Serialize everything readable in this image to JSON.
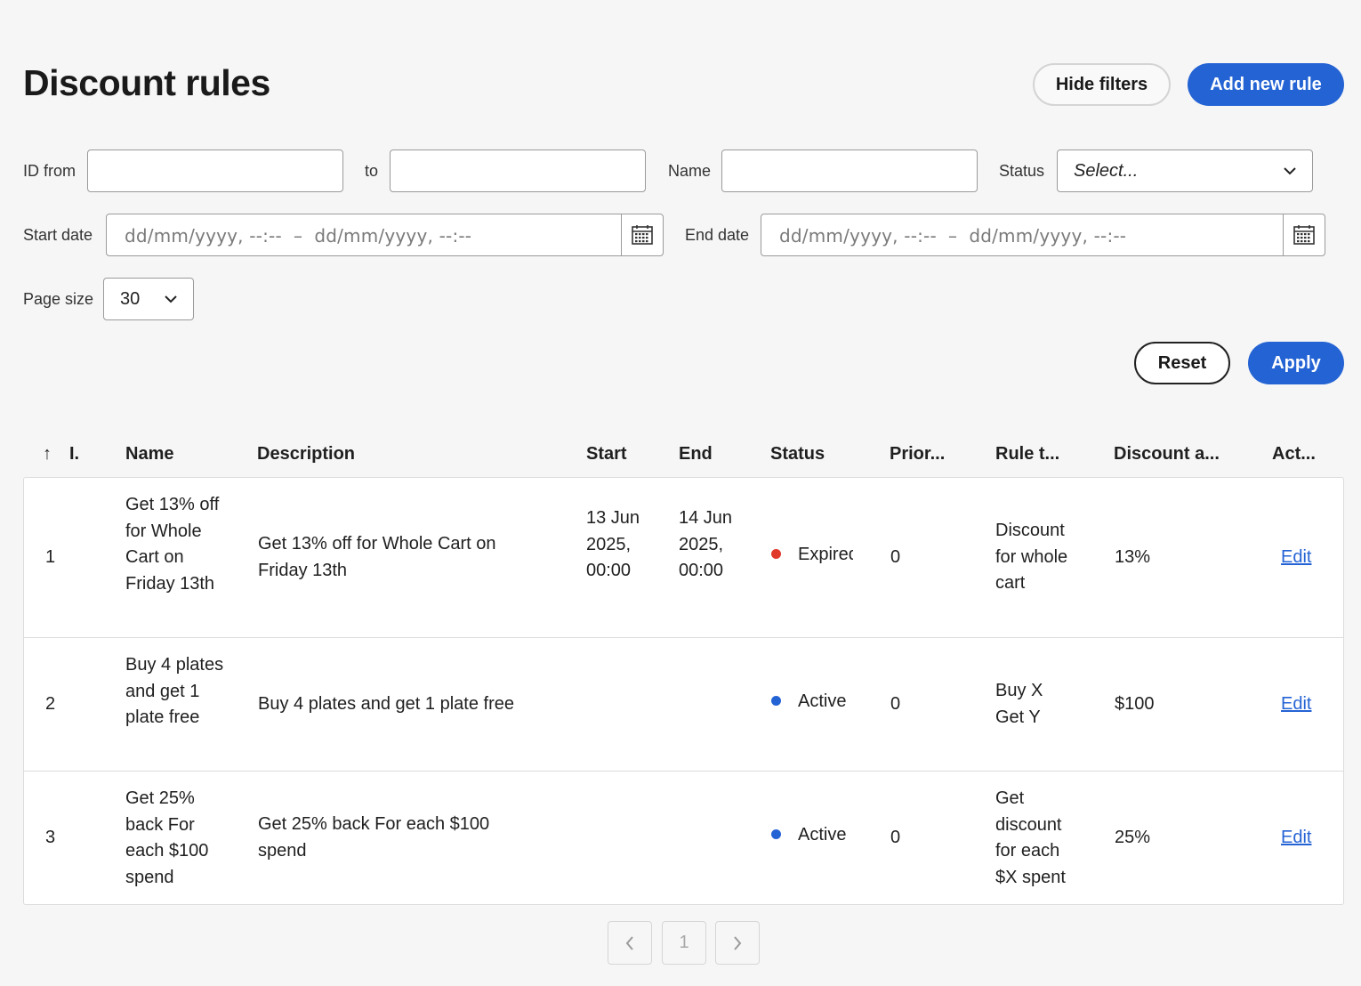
{
  "page": {
    "title": "Discount rules"
  },
  "header": {
    "hide_filters_label": "Hide filters",
    "add_rule_label": "Add new rule"
  },
  "filters": {
    "id_from_label": "ID from",
    "id_to_label": "to",
    "name_label": "Name",
    "status_label": "Status",
    "status_placeholder": "Select...",
    "start_date_label": "Start date",
    "end_date_label": "End date",
    "date_range_placeholder": "dd/mm/yyyy, --:--  –  dd/mm/yyyy, --:--",
    "page_size_label": "Page size",
    "page_size_value": "30",
    "reset_label": "Reset",
    "apply_label": "Apply"
  },
  "table": {
    "columns": [
      "I.",
      "Name",
      "Description",
      "Start",
      "End",
      "Status",
      "Prior...",
      "Rule t...",
      "Discount a...",
      "Act..."
    ],
    "sort_indicator": "↑",
    "rows": [
      {
        "id": "1",
        "name": "Get 13% off for Whole Cart on Friday 13th",
        "description": "Get 13% off for Whole Cart on Friday 13th",
        "start": "13 Jun 2025, 00:00",
        "end": "14 Jun 2025, 00:00",
        "status": "Expired",
        "status_color": "#e0382b",
        "priority": "0",
        "rule_type": "Discount for whole cart",
        "discount": "13%",
        "action": "Edit"
      },
      {
        "id": "2",
        "name": "Buy 4 plates and get 1 plate free",
        "description": "Buy 4 plates and get 1 plate free",
        "start": "",
        "end": "",
        "status": "Active",
        "status_color": "#2463d4",
        "priority": "0",
        "rule_type": "Buy X Get Y",
        "discount": "$100",
        "action": "Edit"
      },
      {
        "id": "3",
        "name": "Get 25% back For each $100 spend",
        "description": "Get 25% back For each $100 spend",
        "start": "",
        "end": "",
        "status": "Active",
        "status_color": "#2463d4",
        "priority": "0",
        "rule_type": "Get discount for each $X spent",
        "discount": "25%",
        "action": "Edit"
      }
    ]
  },
  "pagination": {
    "current_page": "1"
  },
  "colors": {
    "primary": "#2463d4",
    "background": "#f6f6f6",
    "expired": "#e0382b"
  }
}
